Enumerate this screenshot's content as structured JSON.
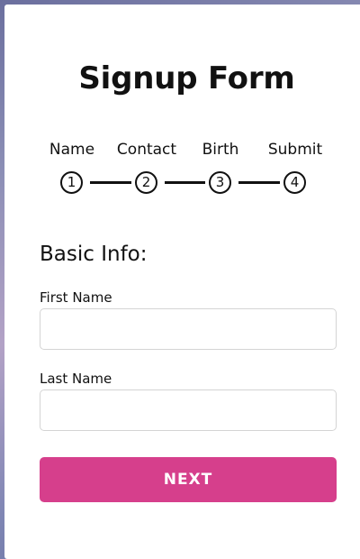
{
  "form": {
    "title": "Signup Form",
    "steps": [
      {
        "label": "Name",
        "number": "1"
      },
      {
        "label": "Contact",
        "number": "2"
      },
      {
        "label": "Birth",
        "number": "3"
      },
      {
        "label": "Submit",
        "number": "4"
      }
    ],
    "section_heading": "Basic Info:",
    "fields": [
      {
        "label": "First Name",
        "value": "",
        "placeholder": ""
      },
      {
        "label": "Last Name",
        "value": "",
        "placeholder": ""
      }
    ],
    "next_label": "NEXT"
  },
  "colors": {
    "accent": "#d63f8c",
    "text": "#111111",
    "card_background": "#ffffff"
  }
}
